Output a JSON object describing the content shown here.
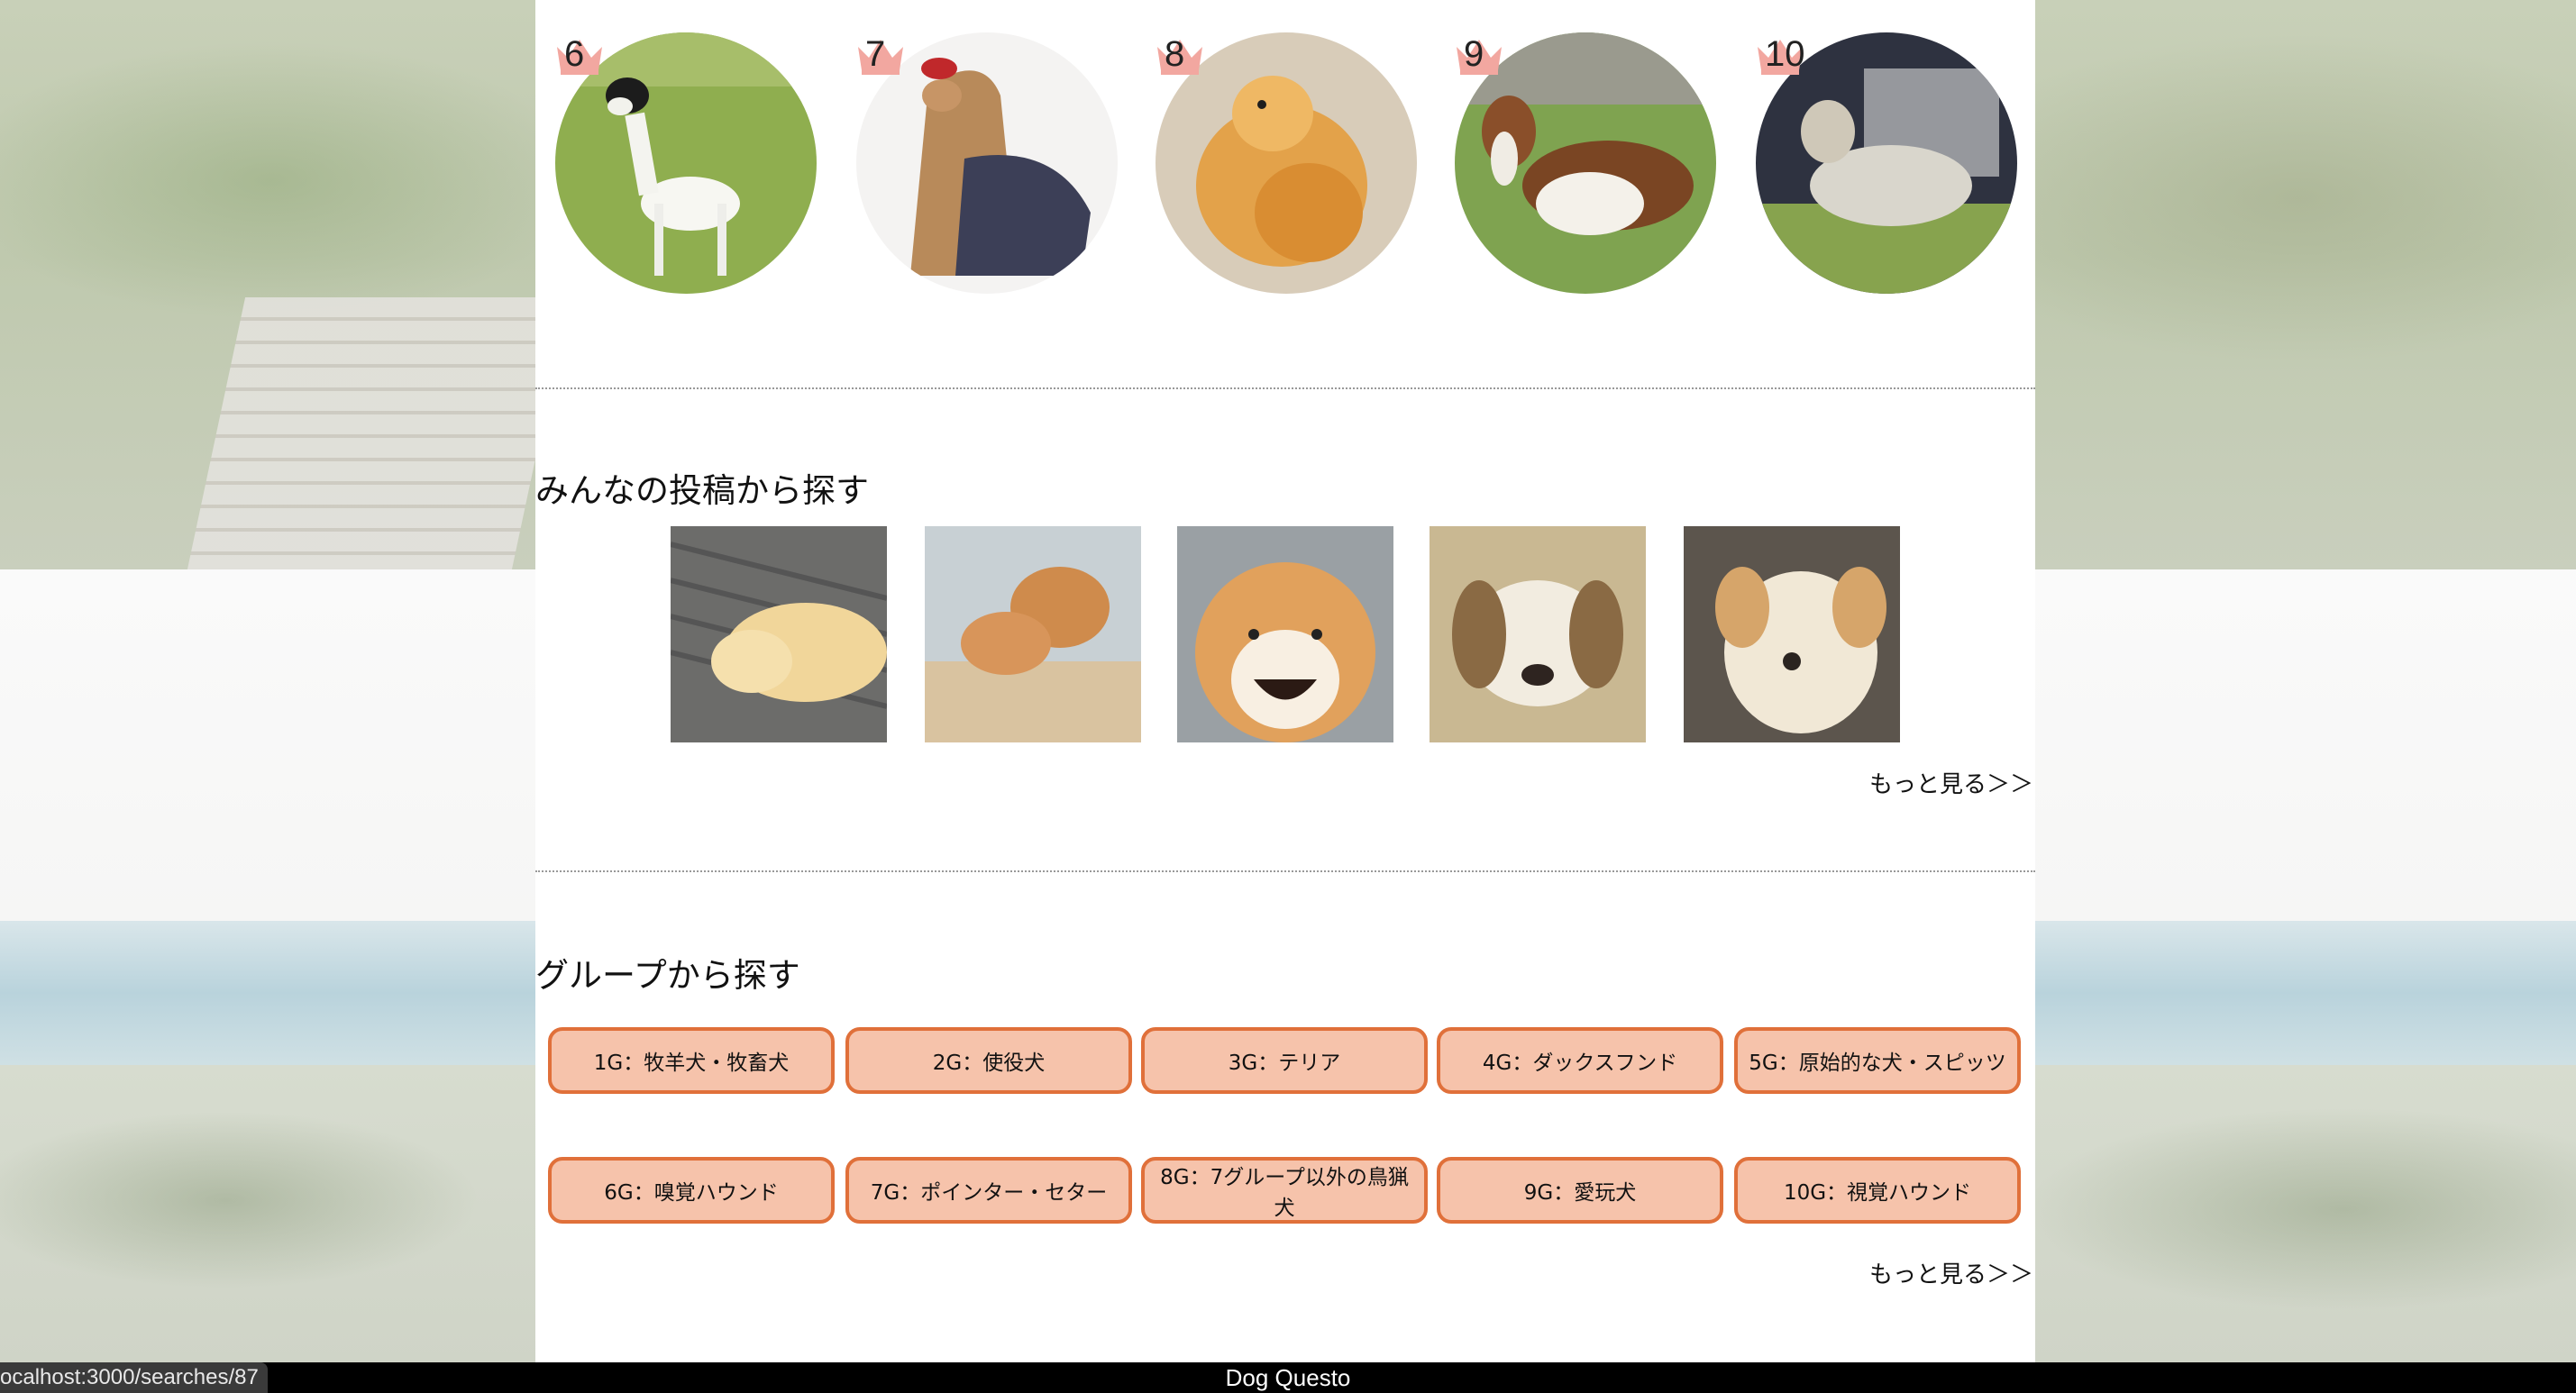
{
  "ranking": {
    "items": [
      {
        "rank": "6",
        "image": "white-terrier-photo"
      },
      {
        "rank": "7",
        "image": "yorkshire-terrier-photo"
      },
      {
        "rank": "8",
        "image": "pomeranian-photo"
      },
      {
        "rank": "9",
        "image": "basset-hound-photo"
      },
      {
        "rank": "10",
        "image": "english-setter-photo"
      }
    ],
    "crown_color": "#f2a7a0"
  },
  "posts": {
    "title": "みんなの投稿から探す",
    "more_label": "もっと見る＞＞",
    "thumbs": [
      "sleeping-golden-puppy-photo",
      "shiba-pair-photo",
      "smiling-shiba-photo",
      "beagle-puppy-photo",
      "labrador-photo"
    ]
  },
  "groups": {
    "title": "グループから探す",
    "more_label": "もっと見る＞＞",
    "buttons": [
      "1G：牧羊犬・牧畜犬",
      "2G：使役犬",
      "3G：テリア",
      "4G：ダックスフンド",
      "5G：原始的な犬・スピッツ",
      "6G：嗅覚ハウンド",
      "7G：ポインター・セター",
      "8G：7グループ以外の鳥猟犬",
      "9G：愛玩犬",
      "10G：視覚ハウンド"
    ],
    "button_bg": "#f6c3ab",
    "button_border": "#e0703a"
  },
  "footer": {
    "title": "Dog Questo"
  },
  "status_bar": {
    "url": "ocalhost:3000/searches/87"
  }
}
